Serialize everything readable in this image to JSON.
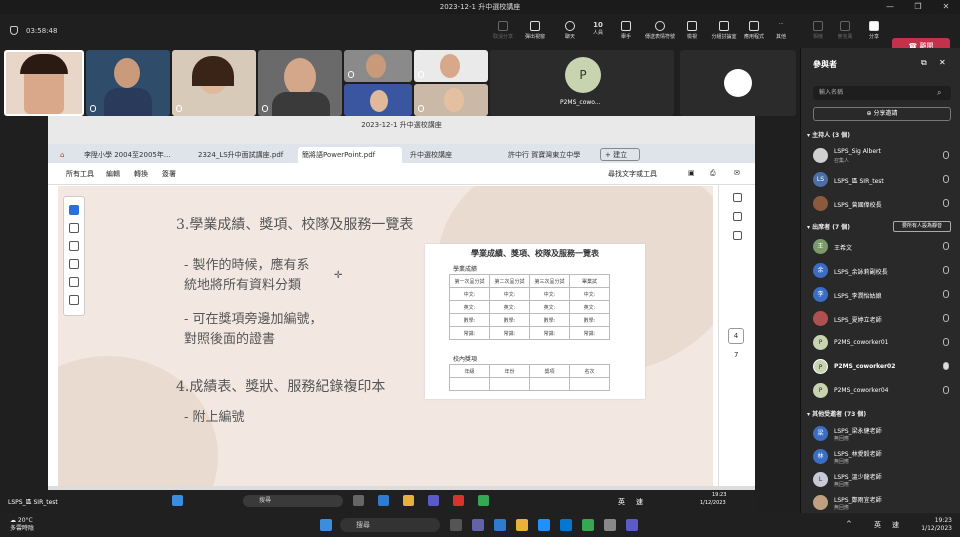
{
  "window": {
    "title": "2023-12-1 升中選校講座"
  },
  "toolbar": {
    "timer": "03:58:48",
    "buttons": [
      {
        "label": "取消分享"
      },
      {
        "label": "彈出視窗"
      },
      {
        "label": "聊天"
      },
      {
        "label": "人員",
        "count": "10"
      },
      {
        "label": "舉手"
      },
      {
        "label": "傳送表情符號"
      },
      {
        "label": "檢視"
      },
      {
        "label": "分組討論室"
      },
      {
        "label": "應用程式"
      },
      {
        "label": "其他"
      },
      {
        "label": "相機"
      },
      {
        "label": "麥克風"
      },
      {
        "label": "分享"
      }
    ],
    "leave_label": "離開"
  },
  "tiles": {
    "p2ms_label": "P2MS_cowo...",
    "p2ms_initial": "P"
  },
  "shared": {
    "window_title": "2023-12-1 升中選校講座",
    "tabs": [
      "李陞小學 2004至2005年...",
      "2324_LS升中面試講座.pdf",
      "簡將語PowerPoint.pdf",
      "升中選校講座",
      "許中行 賀寶灣東立中學",
      "+ 建立"
    ],
    "menu": [
      "所有工具",
      "編輯",
      "轉換",
      "簽署"
    ],
    "search_text": "尋找文字或工具",
    "slide": {
      "heading1": "3.學業成績、獎項、校隊及服務一覽表",
      "bullet1a": "- 製作的時候，應有系",
      "bullet1b": "統地將所有資料分類",
      "bullet2a": "- 可在獎項旁邊加編號，",
      "bullet2b": "對照後面的證書",
      "heading2": "4.成績表、獎狀、服務紀錄複印本",
      "bullet3": "- 附上編號"
    },
    "table_card": {
      "title": "學業成績、獎項、校隊及服務一覽表",
      "sub1": "學業成績",
      "head": [
        "第一次呈分試",
        "第二次呈分試",
        "第三次呈分試",
        "畢業試"
      ],
      "rows": [
        [
          "中文:",
          "中文:",
          "中文:",
          "中文:"
        ],
        [
          "英文:",
          "英文:",
          "英文:",
          "英文:"
        ],
        [
          "數學:",
          "數學:",
          "數學:",
          "數學:"
        ],
        [
          "常識:",
          "常識:",
          "常識:",
          "常識:"
        ]
      ],
      "sub2": "校內獎項",
      "head2": [
        "年級",
        "年份",
        "獎項",
        "名次"
      ]
    },
    "page_current": "4",
    "page_total": "7",
    "inner_search": "搜尋",
    "inner_clock": "19:23",
    "inner_date": "1/12/2023",
    "inner_lang": "英",
    "inner_ime": "速"
  },
  "sharer_label": "LSPS_區 SIR_test",
  "panel": {
    "title": "參與者",
    "search_placeholder": "輸入名稱",
    "share_invite": "分享邀請",
    "sec_hosts": "主持人 (3 個)",
    "sec_presenters": "出席者 (7 個)",
    "mute_all": "要所有人設為靜音",
    "sec_others": "其他受邀者 (73 個)",
    "hosts": [
      {
        "name": "LSPS_Sig Albert",
        "role": "召集人",
        "initial": "",
        "color": "#d0d0d0"
      },
      {
        "name": "LSPS_區 SIR_test",
        "role": "",
        "initial": "LS",
        "color": "#4a6fa5"
      },
      {
        "name": "LSPS_曾國偉校長",
        "role": "",
        "initial": "",
        "color": "#8b5a3c"
      }
    ],
    "presenters": [
      {
        "name": "王希文",
        "initial": "王",
        "color": "#7a9a6a"
      },
      {
        "name": "LSPS_余詠莉副校長",
        "initial": "余",
        "color": "#3a6ec4"
      },
      {
        "name": "LSPS_李潤怡姑娘",
        "initial": "李",
        "color": "#3a6ec4"
      },
      {
        "name": "LSPS_夏婷立老師",
        "initial": "",
        "color": "#b05050"
      },
      {
        "name": "P2MS_coworker01",
        "initial": "P",
        "color": "#c8d3b0"
      },
      {
        "name": "P2MS_coworker02",
        "initial": "P",
        "color": "#c8d3b0"
      },
      {
        "name": "P2MS_coworker04",
        "initial": "P",
        "color": "#c8d3b0"
      }
    ],
    "others": [
      {
        "name": "LSPS_梁永健老師",
        "role": "無回應",
        "initial": "梁",
        "color": "#3a6ec4"
      },
      {
        "name": "LSPS_林愛毅老師",
        "role": "無回應",
        "initial": "林",
        "color": "#3a6ec4"
      },
      {
        "name": "LSPS_溫少龍老師",
        "role": "無回應",
        "initial": "L",
        "color": "#c8c8d8"
      },
      {
        "name": "LSPS_鄭雨宜老師",
        "role": "無回應",
        "initial": "",
        "color": "#c0a080"
      }
    ]
  },
  "taskbar": {
    "temp": "20°C",
    "weather": "多雲時陰",
    "search": "搜尋",
    "lang": "英",
    "ime": "速",
    "time": "19:23",
    "date": "1/12/2023"
  }
}
